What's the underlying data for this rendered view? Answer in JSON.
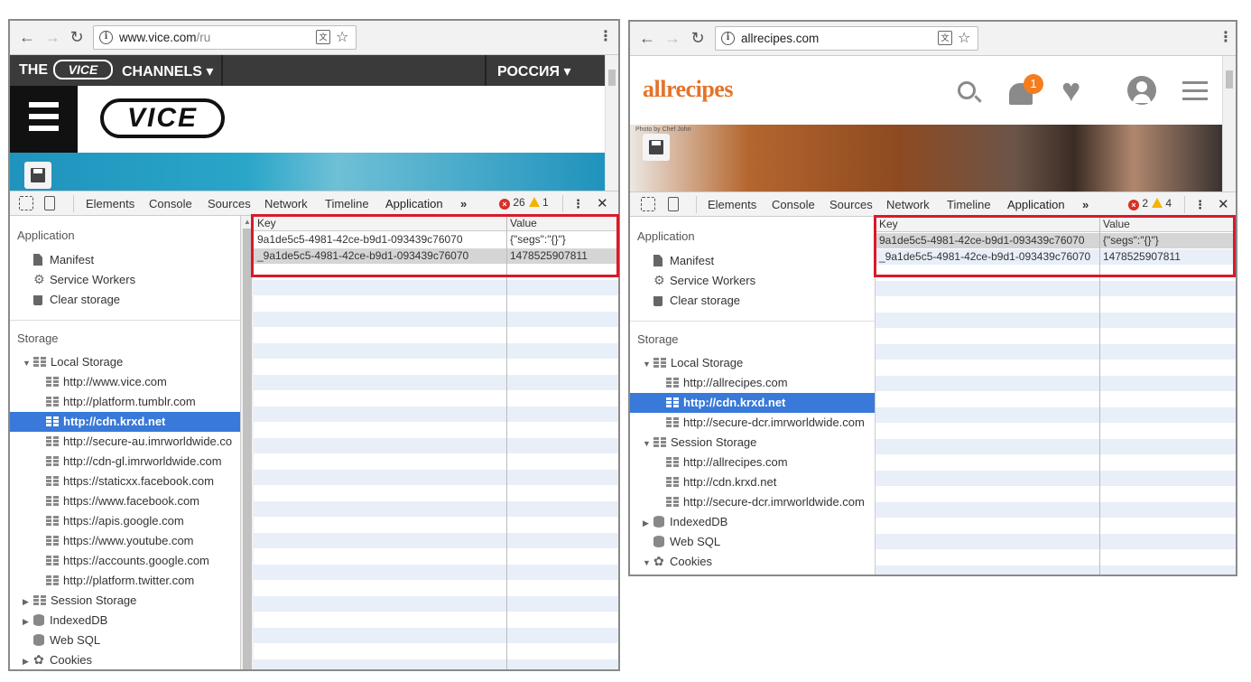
{
  "left": {
    "url_host": "www.vice.com",
    "url_path": "/ru",
    "page": {
      "the": "THE",
      "channels": "CHANNELS",
      "region": "РОССИЯ",
      "logo": "VICE",
      "colors": {
        "bar": "#3a3a3a",
        "hero": "#1f93bd"
      }
    },
    "tabs": [
      "Elements",
      "Console",
      "Sources",
      "Network",
      "Timeline",
      "Application"
    ],
    "more": "»",
    "errors": "26",
    "warnings": "1",
    "sidebar": {
      "application_title": "Application",
      "app_items": [
        "Manifest",
        "Service Workers",
        "Clear storage"
      ],
      "storage_title": "Storage",
      "local_storage": "Local Storage",
      "origins": [
        "http://www.vice.com",
        "http://platform.tumblr.com",
        "http://cdn.krxd.net",
        "http://secure-au.imrworldwide.co",
        "http://cdn-gl.imrworldwide.com",
        "https://staticxx.facebook.com",
        "https://www.facebook.com",
        "https://apis.google.com",
        "https://www.youtube.com",
        "https://accounts.google.com",
        "http://platform.twitter.com"
      ],
      "selected_index": 2,
      "bottom": [
        "Session Storage",
        "IndexedDB",
        "Web SQL",
        "Cookies"
      ]
    },
    "table": {
      "key_header": "Key",
      "value_header": "Value",
      "rows": [
        {
          "key": "9a1de5c5-4981-42ce-b9d1-093439c76070",
          "value": "{\"segs\":\"{}\"}"
        },
        {
          "key": "_9a1de5c5-4981-42ce-b9d1-093439c76070",
          "value": "1478525907811"
        }
      ]
    }
  },
  "right": {
    "url_host": "allrecipes.com",
    "page": {
      "logo": "allrecipes",
      "badge": "1",
      "photo_credit": "Photo by Chef John",
      "colors": {
        "logo": "#e5732a",
        "badge": "#f47d20"
      }
    },
    "tabs": [
      "Elements",
      "Console",
      "Sources",
      "Network",
      "Timeline",
      "Application"
    ],
    "more": "»",
    "errors": "2",
    "warnings": "4",
    "sidebar": {
      "application_title": "Application",
      "app_items": [
        "Manifest",
        "Service Workers",
        "Clear storage"
      ],
      "storage_title": "Storage",
      "local_storage": "Local Storage",
      "local_origins": [
        "http://allrecipes.com",
        "http://cdn.krxd.net",
        "http://secure-dcr.imrworldwide.com"
      ],
      "selected_index": 1,
      "session_storage": "Session Storage",
      "session_origins": [
        "http://allrecipes.com",
        "http://cdn.krxd.net",
        "http://secure-dcr.imrworldwide.com"
      ],
      "bottom": [
        "IndexedDB",
        "Web SQL",
        "Cookies"
      ]
    },
    "table": {
      "key_header": "Key",
      "value_header": "Value",
      "rows": [
        {
          "key": "9a1de5c5-4981-42ce-b9d1-093439c76070",
          "value": "{\"segs\":\"{}\"}"
        },
        {
          "key": "_9a1de5c5-4981-42ce-b9d1-093439c76070",
          "value": "1478525907811"
        }
      ]
    }
  },
  "accent": "#d71a2a",
  "selection": "#3879d9"
}
